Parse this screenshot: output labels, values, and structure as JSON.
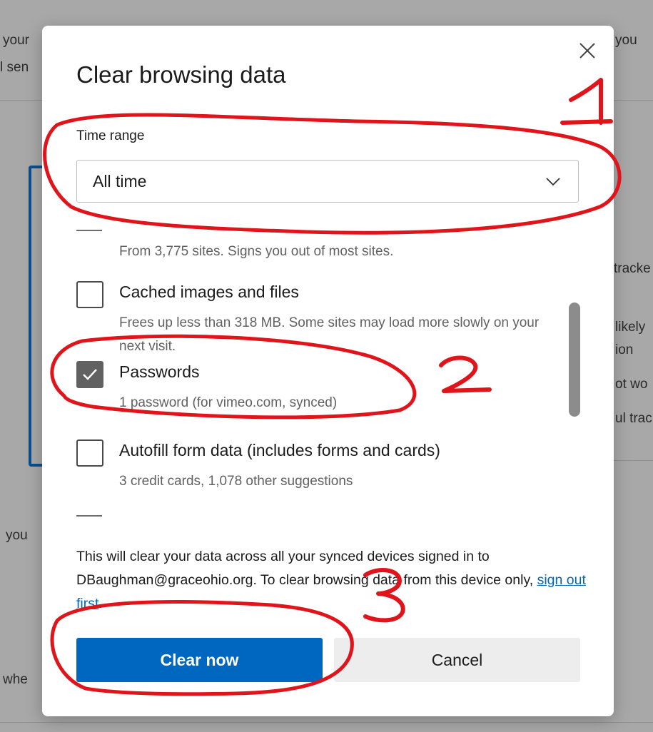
{
  "background": {
    "fragments": [
      "your",
      "l sen",
      "you",
      "tracke",
      "likely",
      "ion",
      "ot wo",
      "ul trac",
      "you",
      "whe"
    ]
  },
  "dialog": {
    "title": "Clear browsing data",
    "time_range_label": "Time range",
    "time_range_value": "All time",
    "items": [
      {
        "label": "",
        "desc": "From 3,775 sites. Signs you out of most sites.",
        "checked": false
      },
      {
        "label": "Cached images and files",
        "desc": "Frees up less than 318 MB. Some sites may load more slowly on your next visit.",
        "checked": false
      },
      {
        "label": "Passwords",
        "desc": "1 password (for vimeo.com, synced)",
        "checked": true
      },
      {
        "label": "Autofill form data (includes forms and cards)",
        "desc": "3 credit cards, 1,078 other suggestions",
        "checked": false
      }
    ],
    "sync_notice_pre": "This will clear your data across all your synced devices signed in to DBaughman@graceohio.org. To clear browsing data from this device only, ",
    "sync_notice_link": "sign out first",
    "sync_notice_post": ".",
    "clear_button": "Clear now",
    "cancel_button": "Cancel"
  },
  "annotations": {
    "numbers": [
      "1",
      "2",
      "3"
    ],
    "color": "#e0141b"
  },
  "colors": {
    "primary": "#0067c0",
    "link": "#0067b8",
    "checked": "#616161"
  }
}
